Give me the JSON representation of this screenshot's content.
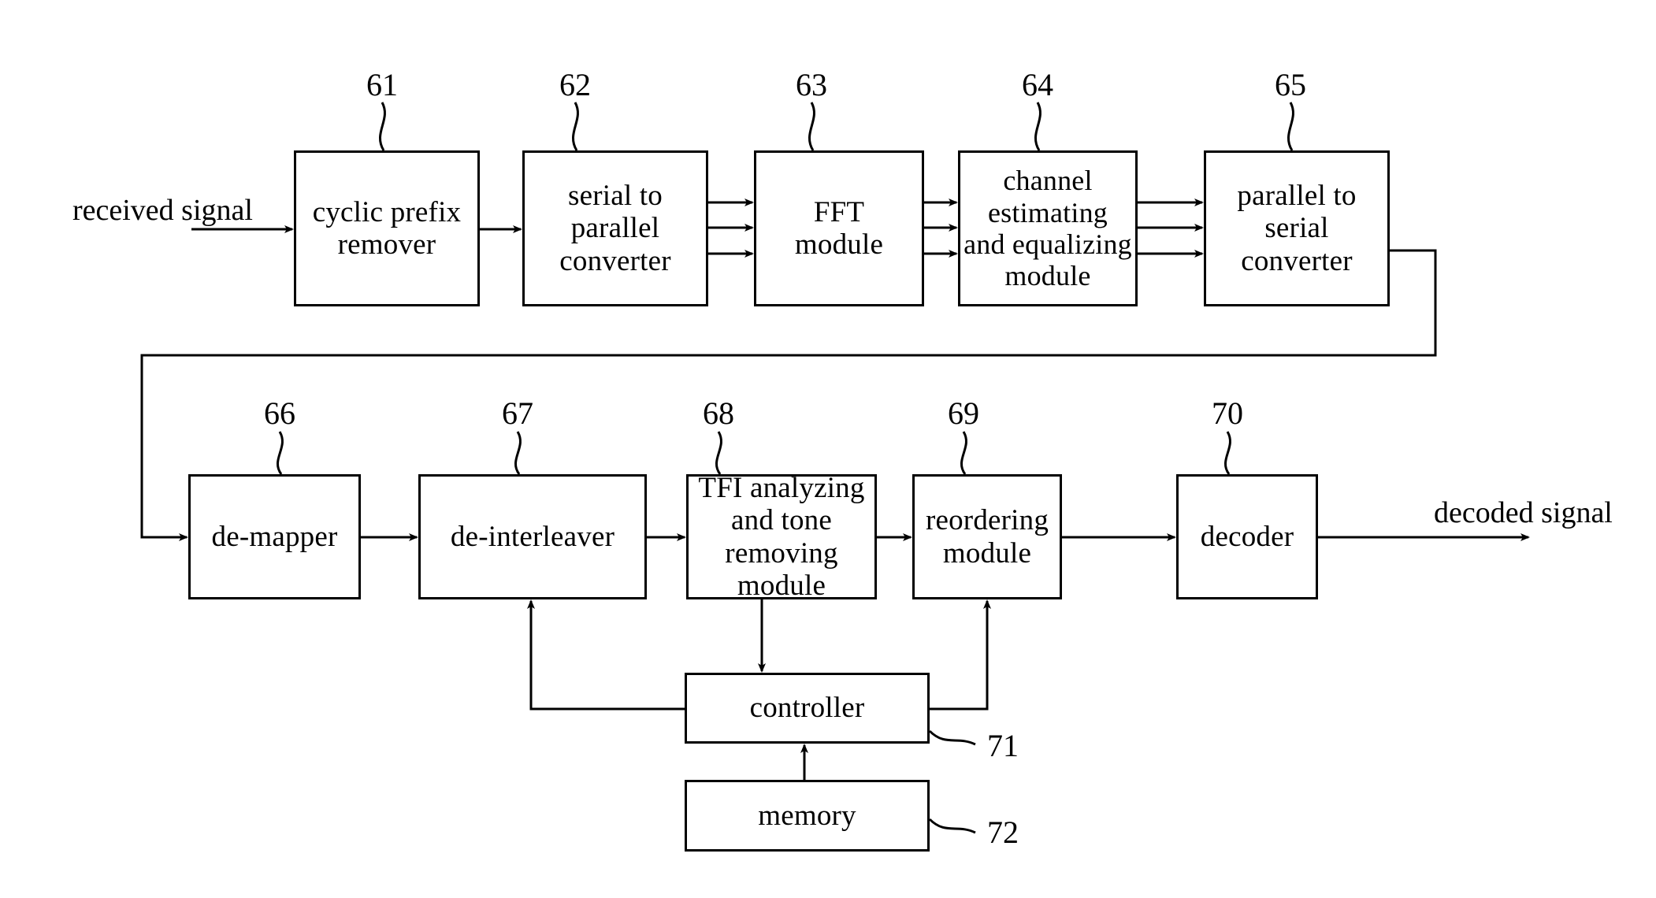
{
  "figure": {
    "type": "block-diagram",
    "title": "OFDM receiver block diagram",
    "io_labels": {
      "input": "received signal",
      "output": "decoded signal"
    },
    "blocks": [
      {
        "ref": "61",
        "label": "cyclic prefix\nremover",
        "lines": [
          "cyclic prefix",
          "remover"
        ]
      },
      {
        "ref": "62",
        "label": "serial to\nparallel\nconverter",
        "lines": [
          "serial to",
          "parallel",
          "converter"
        ]
      },
      {
        "ref": "63",
        "label": "FFT\nmodule",
        "lines": [
          "FFT",
          "module"
        ]
      },
      {
        "ref": "64",
        "label": "channel\nestimating\nand equalizing\nmodule",
        "lines": [
          "channel",
          "estimating",
          "and equalizing",
          "module"
        ]
      },
      {
        "ref": "65",
        "label": "parallel to\nserial\nconverter",
        "lines": [
          "parallel to",
          "serial",
          "converter"
        ]
      },
      {
        "ref": "66",
        "label": "de-mapper",
        "lines": [
          "de-mapper"
        ]
      },
      {
        "ref": "67",
        "label": "de-interleaver",
        "lines": [
          "de-interleaver"
        ]
      },
      {
        "ref": "68",
        "label": "TFI analyzing\nand tone\nremoving module",
        "lines": [
          "TFI analyzing",
          "and tone",
          "removing module"
        ]
      },
      {
        "ref": "69",
        "label": "reordering\nmodule",
        "lines": [
          "reordering",
          "module"
        ]
      },
      {
        "ref": "70",
        "label": "decoder",
        "lines": [
          "decoder"
        ]
      },
      {
        "ref": "71",
        "label": "controller",
        "lines": [
          "controller"
        ]
      },
      {
        "ref": "72",
        "label": "memory",
        "lines": [
          "memory"
        ]
      }
    ]
  },
  "blocks": {
    "b61": {
      "ref": "61",
      "l1": "cyclic prefix",
      "l2": "remover"
    },
    "b62": {
      "ref": "62",
      "l1": "serial to",
      "l2": "parallel",
      "l3": "converter"
    },
    "b63": {
      "ref": "63",
      "l1": "FFT",
      "l2": "module"
    },
    "b64": {
      "ref": "64",
      "l1": "channel",
      "l2": "estimating",
      "l3": "and equalizing",
      "l4": "module"
    },
    "b65": {
      "ref": "65",
      "l1": "parallel to",
      "l2": "serial",
      "l3": "converter"
    },
    "b66": {
      "ref": "66",
      "l1": "de-mapper"
    },
    "b67": {
      "ref": "67",
      "l1": "de-interleaver"
    },
    "b68": {
      "ref": "68",
      "l1": "TFI analyzing",
      "l2": "and tone",
      "l3": "removing module"
    },
    "b69": {
      "ref": "69",
      "l1": "reordering",
      "l2": "module"
    },
    "b70": {
      "ref": "70",
      "l1": "decoder"
    },
    "b71": {
      "ref": "71",
      "l1": "controller"
    },
    "b72": {
      "ref": "72",
      "l1": "memory"
    }
  },
  "io": {
    "input_label": "received signal",
    "output_label": "decoded signal"
  },
  "colors": {
    "stroke": "#000000",
    "background": "#ffffff"
  }
}
